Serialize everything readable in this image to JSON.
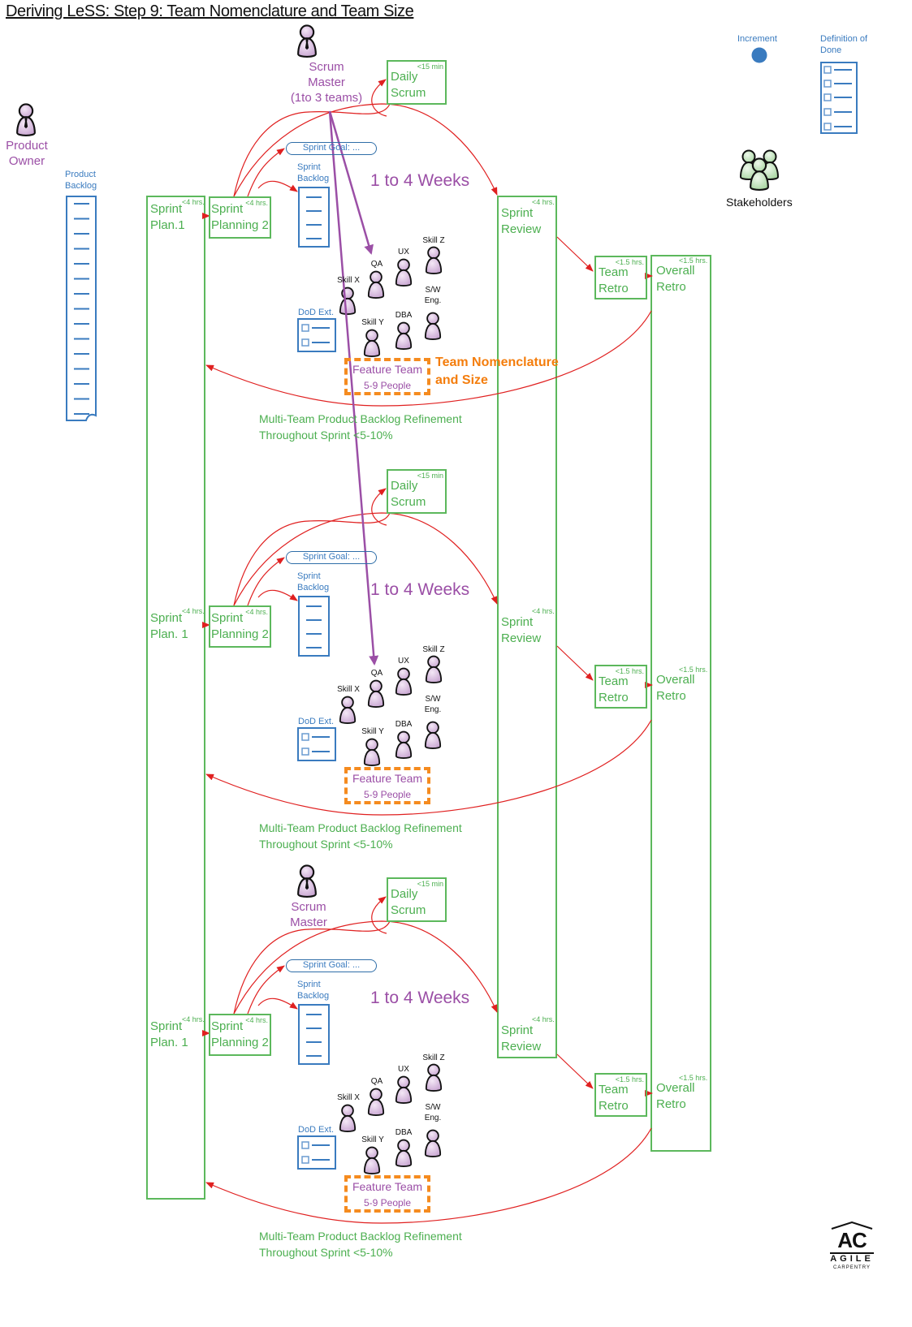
{
  "title": "Deriving LeSS: Step 9: Team Nomenclature and Team Size",
  "roles": {
    "product_owner": "Product\nOwner",
    "product_owner_line1": "Product",
    "product_owner_line2": "Owner",
    "scrum_master_top_line1": "Scrum",
    "scrum_master_top_line2": "Master",
    "scrum_master_top_line3": "(1to 3 teams)",
    "scrum_master_bottom_line1": "Scrum",
    "scrum_master_bottom_line2": "Master",
    "stakeholders": "Stakeholders"
  },
  "artifacts": {
    "product_backlog_line1": "Product",
    "product_backlog_line2": "Backlog",
    "increment": "Increment",
    "dod_line1": "Definition of",
    "dod_line2": "Done"
  },
  "shared_events": {
    "sprint_review_label_line1": "Sprint",
    "sprint_review_label_line2": "Review",
    "sprint_review_duration": "<4 hrs.",
    "overall_retro_line1": "Overall",
    "overall_retro_line2": "Retro",
    "overall_retro_duration": "<1.5 hrs."
  },
  "teams": [
    {
      "sprint_plan1_line1": "Sprint",
      "sprint_plan1_line2": "Plan.1",
      "sprint_plan1_duration": "<4 hrs.",
      "sprint_planning2_line1": "Sprint",
      "sprint_planning2_line2": "Planning 2",
      "sprint_planning2_duration": "<4 hrs.",
      "daily_scrum_line1": "Daily",
      "daily_scrum_line2": "Scrum",
      "daily_scrum_duration": "<15 min",
      "sprint_goal": "Sprint Goal: ...",
      "sprint_backlog_line1": "Sprint",
      "sprint_backlog_line2": "Backlog",
      "sprint_length": "1 to 4 Weeks",
      "dod_ext": "DoD Ext.",
      "members": [
        "Skill X",
        "QA",
        "UX",
        "Skill Z",
        "S/W\nEng.",
        "Skill Y",
        "DBA"
      ],
      "feature_team_line1": "Feature Team",
      "feature_team_line2": "5-9 People",
      "team_retro_line1": "Team",
      "team_retro_line2": "Retro",
      "team_retro_duration": "<1.5 hrs.",
      "refinement_line1": "Multi-Team Product Backlog Refinement",
      "refinement_line2": "Throughout Sprint <5-10%"
    },
    {
      "sprint_plan1_line1": "Sprint",
      "sprint_plan1_line2": "Plan. 1",
      "sprint_plan1_duration": "<4 hrs.",
      "sprint_planning2_line1": "Sprint",
      "sprint_planning2_line2": "Planning 2",
      "sprint_planning2_duration": "<4 hrs.",
      "daily_scrum_line1": "Daily",
      "daily_scrum_line2": "Scrum",
      "daily_scrum_duration": "<15 min",
      "sprint_goal": "Sprint Goal: ...",
      "sprint_backlog_line1": "Sprint",
      "sprint_backlog_line2": "Backlog",
      "sprint_length": "1 to 4 Weeks",
      "dod_ext": "DoD Ext.",
      "members": [
        "Skill X",
        "QA",
        "UX",
        "Skill Z",
        "S/W\nEng.",
        "Skill Y",
        "DBA"
      ],
      "feature_team_line1": "Feature Team",
      "feature_team_line2": "5-9 People",
      "team_retro_line1": "Team",
      "team_retro_line2": "Retro",
      "team_retro_duration": "<1.5 hrs.",
      "refinement_line1": "Multi-Team Product Backlog Refinement",
      "refinement_line2": "Throughout Sprint <5-10%"
    },
    {
      "sprint_plan1_line1": "Sprint",
      "sprint_plan1_line2": "Plan. 1",
      "sprint_plan1_duration": "<4 hrs.",
      "sprint_planning2_line1": "Sprint",
      "sprint_planning2_line2": "Planning 2",
      "sprint_planning2_duration": "<4 hrs.",
      "daily_scrum_line1": "Daily",
      "daily_scrum_line2": "Scrum",
      "daily_scrum_duration": "<15 min",
      "sprint_goal": "Sprint Goal: ...",
      "sprint_backlog_line1": "Sprint",
      "sprint_backlog_line2": "Backlog",
      "sprint_length": "1 to 4 Weeks",
      "dod_ext": "DoD Ext.",
      "members": [
        "Skill X",
        "QA",
        "UX",
        "Skill Z",
        "S/W\nEng.",
        "Skill Y",
        "DBA"
      ],
      "feature_team_line1": "Feature Team",
      "feature_team_line2": "5-9 People",
      "team_retro_line1": "Team",
      "team_retro_line2": "Retro",
      "team_retro_duration": "<1.5 hrs.",
      "refinement_line1": "Multi-Team Product Backlog Refinement",
      "refinement_line2": "Throughout Sprint <5-10%"
    }
  ],
  "callout": {
    "line1": "Team Nomenclature",
    "line2": "and Size"
  },
  "logo": {
    "mark": "AC",
    "name": "AGILE",
    "sub": "CARPENTRY"
  },
  "colors": {
    "event_green": "#5cb85c",
    "artifact_blue": "#3a7bbf",
    "role_purple": "#9b4fa6",
    "flow_red": "#e02020",
    "highlight_orange": "#f47d0c"
  }
}
